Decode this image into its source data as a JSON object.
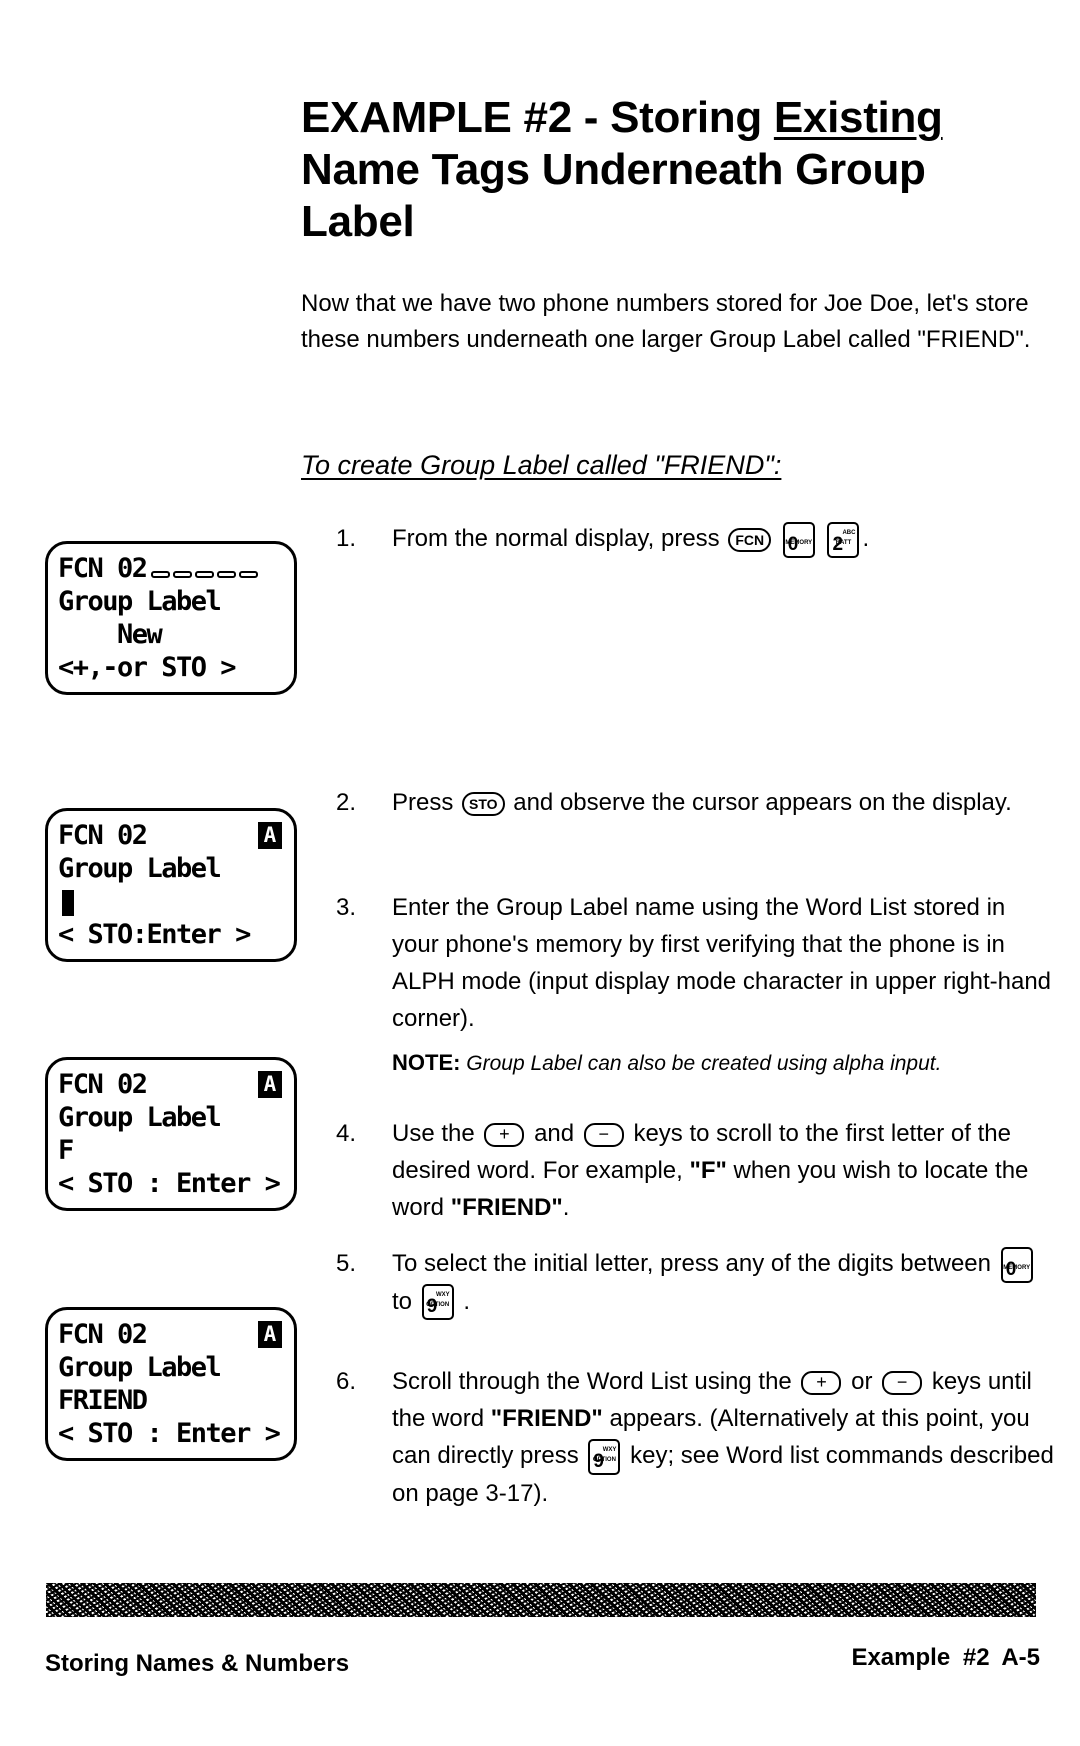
{
  "title": {
    "line1_prefix": "EXAMPLE #2 - Storing ",
    "line1_underlined": "Existing",
    "line2": "Name Tags Underneath Group",
    "line3": "Label"
  },
  "intro": "Now that we have two phone numbers stored for Joe Doe, let's store these numbers underneath one larger Group Label called \"FRIEND\".",
  "subheading": "To create Group Label called \"FRIEND\":",
  "displays": [
    {
      "rows": [
        "FCN 02",
        "Group Label",
        "    New",
        "<+,-or STO >"
      ],
      "mode_badge": ""
    },
    {
      "rows": [
        "FCN 02",
        "Group Label",
        "",
        "< STO:Enter >"
      ],
      "mode_badge": "A"
    },
    {
      "rows": [
        "FCN 02",
        "Group Label",
        "F",
        "< STO : Enter >"
      ],
      "mode_badge": "A"
    },
    {
      "rows": [
        "FCN 02",
        "Group Label",
        "FRIEND",
        "< STO : Enter >"
      ],
      "mode_badge": "A"
    }
  ],
  "keys": {
    "fcn": "FCN",
    "sto": "STO",
    "zero": {
      "top": "MEMORY",
      "main": "0",
      "sub": ""
    },
    "two": {
      "top": "BATT",
      "main": "2",
      "sub": "ABC"
    },
    "nine": {
      "top": "OPTION",
      "main": "9",
      "sub": "WXY"
    },
    "plus": "+",
    "minus": "−"
  },
  "steps": [
    {
      "num": "1.",
      "before": "From the normal display, press",
      "after": "."
    },
    {
      "num": "2.",
      "before": "Press",
      "after": "and observe the cursor appears on the display."
    },
    {
      "num": "3.",
      "text": "Enter the Group Label name using the Word List stored in your phone's memory by first verifying that the phone is in ALPH mode (input display mode character in upper right-hand corner)."
    },
    {
      "num": "4.",
      "before": "Use the",
      "mid": "and",
      "after": "keys to scroll to the first letter of the desired word.  For example, ",
      "bold1": "\"F\"",
      "after2": " when you wish to locate the word ",
      "bold2": "\"FRIEND\"",
      "end": "."
    },
    {
      "num": "5.",
      "before": "To select the initial letter, press any of the digits between",
      "mid": "to",
      "after": "."
    },
    {
      "num": "6.",
      "before": "Scroll through the Word List using the",
      "mid": "or",
      "after": "keys until the word ",
      "bold1": "\"FRIEND\"",
      "after2": " appears.  (Alternatively at this point, you can directly press",
      "after3": "key; see Word list commands described on page 3-17)."
    }
  ],
  "note": {
    "label": "NOTE:",
    "text": "Group Label can also be created using alpha input."
  },
  "footer": {
    "left": "Storing Names & Numbers",
    "right_section": "Example #2",
    "page": "A-5"
  }
}
